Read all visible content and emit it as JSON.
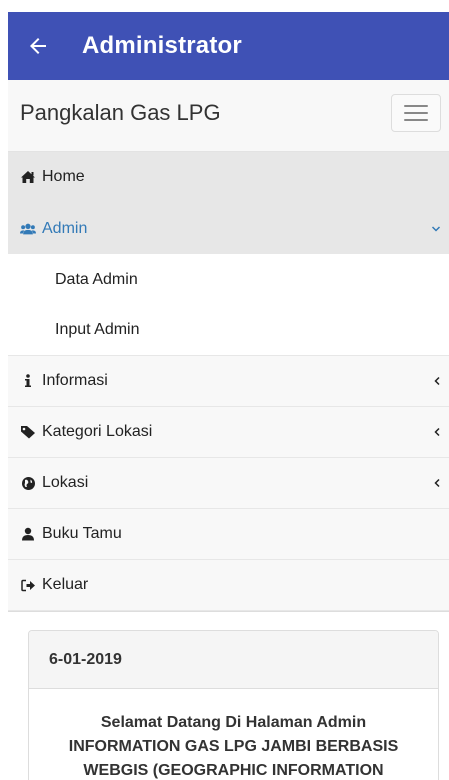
{
  "appbar": {
    "title": "Administrator",
    "color": "#3f51b5"
  },
  "navbar": {
    "brand": "Pangkalan Gas LPG"
  },
  "menu": {
    "home": {
      "label": "Home",
      "icon": "home-icon"
    },
    "admin": {
      "label": "Admin",
      "icon": "users-icon",
      "sub_items": [
        "Data Admin",
        "Input Admin"
      ]
    },
    "informasi": {
      "label": "Informasi",
      "icon": "info-icon"
    },
    "kategori": {
      "label": "Kategori Lokasi",
      "icon": "tag-icon"
    },
    "lokasi": {
      "label": "Lokasi",
      "icon": "globe-icon"
    },
    "buku_tamu": {
      "label": "Buku Tamu",
      "icon": "user-icon"
    },
    "keluar": {
      "label": "Keluar",
      "icon": "sign-out-icon"
    }
  },
  "panel": {
    "date": "6-01-2019",
    "lines": [
      "Selamat Datang Di Halaman Admin",
      "INFORMATION GAS LPG JAMBI BERBASIS",
      "WEBGIS (GEOGRAPHIC INFORMATION"
    ]
  },
  "colors": {
    "accent": "#337ab7",
    "menu_bg": "#f8f8f8",
    "active_bg": "#e7e7e7"
  }
}
